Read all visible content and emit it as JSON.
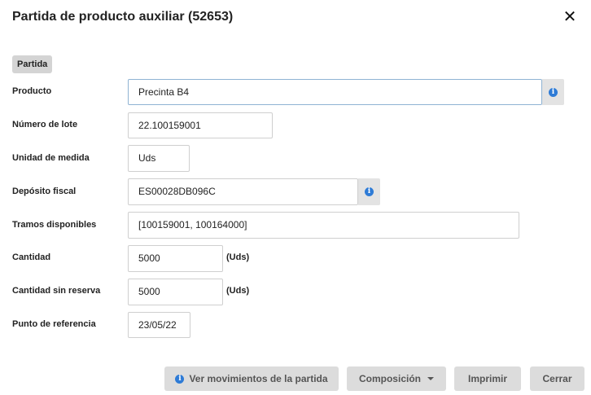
{
  "dialog": {
    "title": "Partida de producto auxiliar (52653)",
    "close_symbol": "✕"
  },
  "section": {
    "label": "Partida"
  },
  "fields": {
    "producto": {
      "label": "Producto",
      "value": "Precinta B4"
    },
    "lote": {
      "label": "Número de lote",
      "value": "22.100159001"
    },
    "unidad": {
      "label": "Unidad de medida",
      "value": "Uds"
    },
    "deposito": {
      "label": "Depósito fiscal",
      "value": "ES00028DB096C"
    },
    "tramos": {
      "label": "Tramos disponibles",
      "value": "[100159001, 100164000]"
    },
    "cantidad": {
      "label": "Cantidad",
      "value": "5000",
      "unit": "(Uds)"
    },
    "cantidad_sin_reserva": {
      "label": "Cantidad sin reserva",
      "value": "5000",
      "unit": "(Uds)"
    },
    "punto_referencia": {
      "label": "Punto de referencia",
      "value": "23/05/22"
    }
  },
  "buttons": {
    "movimientos": "Ver movimientos de la partida",
    "composicion": "Composición",
    "imprimir": "Imprimir",
    "cerrar": "Cerrar"
  },
  "icons": {
    "info": "i"
  },
  "colors": {
    "accent": "#2e7bd6",
    "button_bg": "#dcdcdc"
  }
}
